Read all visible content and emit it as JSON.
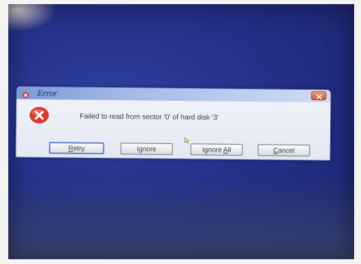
{
  "dialog": {
    "title": "Error",
    "message": "Failed to read from sector '0' of hard disk '3'",
    "buttons": {
      "retry": {
        "prefix": "",
        "accel": "R",
        "suffix": "etry"
      },
      "ignore": {
        "label": "Ignore"
      },
      "ignore_all": {
        "prefix": "Ignore ",
        "accel": "A",
        "suffix": "ll"
      },
      "cancel": {
        "prefix": "",
        "accel": "C",
        "suffix": "ancel"
      }
    }
  },
  "colors": {
    "desktop": "#25318a",
    "error_red": "#d93a2f",
    "close_button": "#d5563b"
  },
  "icons": {
    "title": "error-icon",
    "message": "error-icon",
    "close": "close-icon",
    "pointer": "mouse-cursor-icon"
  }
}
